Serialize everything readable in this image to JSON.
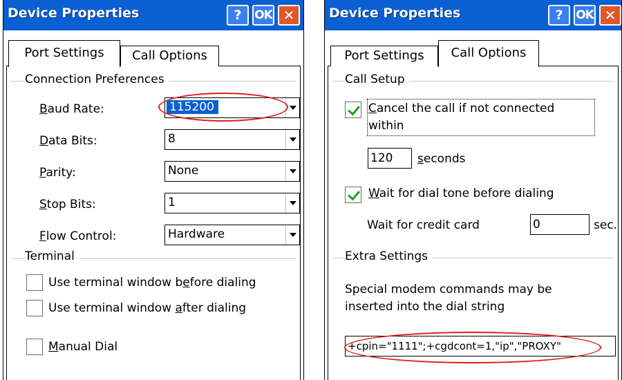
{
  "left_dialog": {
    "title": "Device Properties",
    "buttons": {
      "help": "?",
      "ok": "OK",
      "close": "✕"
    },
    "tabs": [
      {
        "label": "Port Settings",
        "active": true
      },
      {
        "label": "Call Options",
        "active": false
      }
    ],
    "connection_preferences": {
      "heading": "Connection Preferences",
      "fields": [
        {
          "label_hotkey": "B",
          "label_rest": "aud Rate:",
          "value": "115200"
        },
        {
          "label_hotkey": "D",
          "label_rest": "ata Bits:",
          "value": "8"
        },
        {
          "label_hotkey": "P",
          "label_rest": "arity:",
          "value": "None"
        },
        {
          "label_hotkey": "S",
          "label_rest": "top Bits:",
          "value": "1"
        },
        {
          "label_hotkey": "F",
          "label_rest": "low Control:",
          "value": "Hardware"
        }
      ]
    },
    "terminal": {
      "heading": "Terminal",
      "options": [
        {
          "pre": "Use terminal window b",
          "hotkey": "e",
          "post": "fore dialing",
          "checked": false
        },
        {
          "pre": "Use terminal window ",
          "hotkey": "a",
          "post": "fter dialing",
          "checked": false
        }
      ]
    },
    "manual_dial": {
      "hotkey": "M",
      "rest": "anual Dial",
      "checked": false
    }
  },
  "right_dialog": {
    "title": "Device Properties",
    "buttons": {
      "help": "?",
      "ok": "OK",
      "close": "✕"
    },
    "tabs": [
      {
        "label": "Port Settings",
        "active": false
      },
      {
        "label": "Call Options",
        "active": true
      }
    ],
    "call_setup": {
      "heading": "Call Setup",
      "cancel_call": {
        "hotkey": "C",
        "line1_rest": "ancel the call if not connected",
        "line2": "within",
        "checked": true
      },
      "timeout_value": "120",
      "seconds_hotkey": "s",
      "seconds_rest": "econds",
      "wait_dial_tone": {
        "hotkey": "W",
        "rest": "ait for dial tone before dialing",
        "checked": true
      },
      "credit_card_label": "Wait for credit card",
      "credit_card_value": "0",
      "credit_card_unit": "sec."
    },
    "extra_settings": {
      "heading": "Extra Settings",
      "description_line1": "Special modem commands may be",
      "description_line2": "inserted into the dial string",
      "dial_string": "+cpin=\"1111\";+cgdcont=1,\"ip\",\"PROXY\""
    }
  },
  "colors": {
    "titlebar": "#0a5fd3",
    "selection": "#0a5fd3",
    "annotation": "#e31b1b",
    "checkmark": "#1aa01a"
  }
}
